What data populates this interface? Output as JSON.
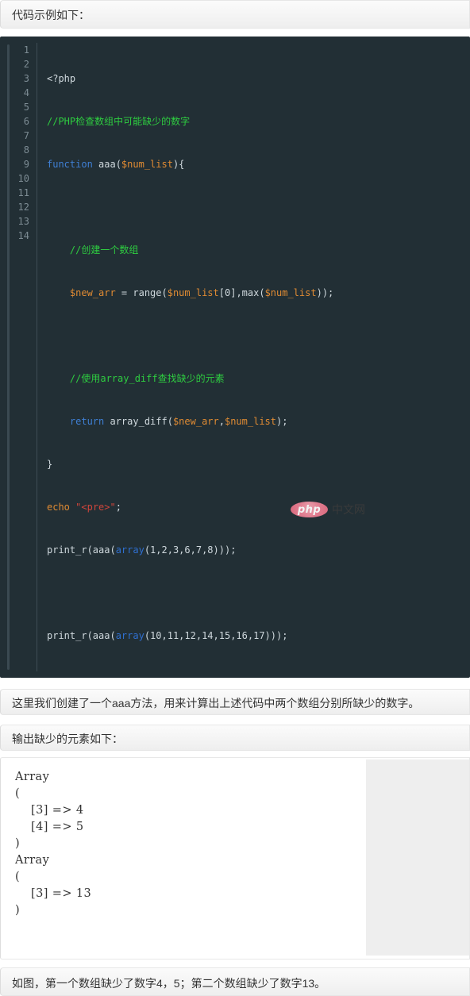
{
  "notes": {
    "intro": "代码示例如下：",
    "explain": "这里我们创建了一个aaa方法，用来计算出上述代码中两个数组分别所缺少的数字。",
    "output_label": "输出缺少的元素如下：",
    "conclusion": "如图，第一个数组缺少了数字4，5；第二个数组缺少了数字13。"
  },
  "code_block": {
    "language": "php",
    "background_color": "#222f35",
    "line_numbers": [
      "1",
      "2",
      "3",
      "4",
      "5",
      "6",
      "7",
      "8",
      "9",
      "10",
      "11",
      "12",
      "13",
      "14"
    ],
    "lines": [
      "<?php",
      "//PHP检查数组中可能缺少的数字",
      "function aaa($num_list){",
      "",
      "    //创建一个数组",
      "    $new_arr = range($num_list[0],max($num_list));",
      "",
      "    //使用array_diff查找缺少的元素",
      "    return array_diff($new_arr,$num_list);",
      "}",
      "echo \"<pre>\";",
      "print_r(aaa(array(1,2,3,6,7,8)));",
      "",
      "print_r(aaa(array(10,11,12,14,15,16,17)));"
    ],
    "colors": {
      "keyword": "#3f7fd4",
      "comment": "#2ecc40",
      "variable": "#e08b33",
      "string": "#d1453b",
      "function": "#2f6fd0",
      "plain": "#cfd8dd",
      "gutter": "#7d8c94"
    }
  },
  "output_block": {
    "text": "Array\n(\n    [3] => 4\n    [4] => 5\n)\nArray\n(\n    [3] => 13\n)"
  },
  "watermark": {
    "badge": "php",
    "label": "中文网",
    "badge_color": "#e46b80"
  }
}
